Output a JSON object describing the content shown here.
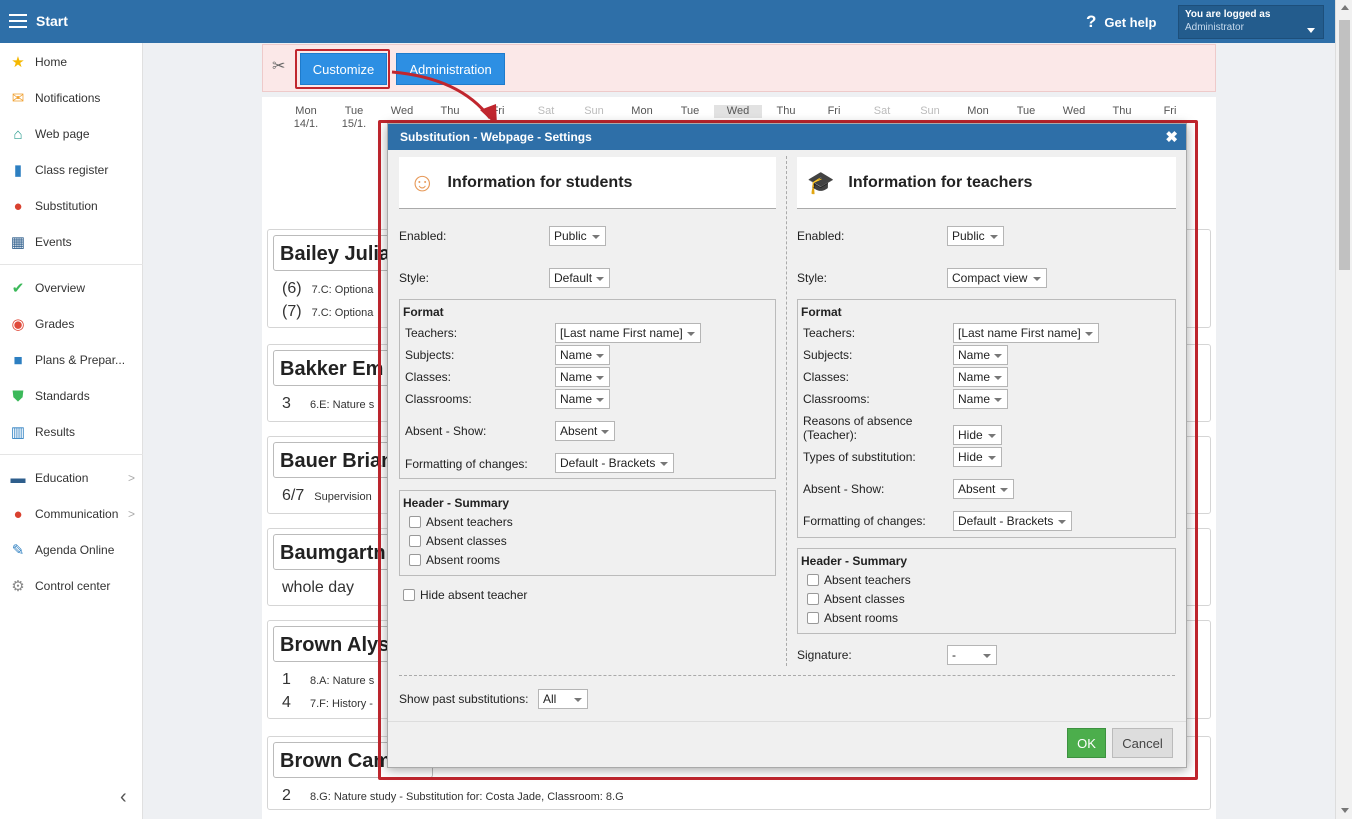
{
  "topbar": {
    "title": "Start",
    "help": "Get help",
    "login_line1": "You are logged as",
    "login_line2": "Administrator"
  },
  "sidebar": {
    "items": [
      {
        "label": "Home",
        "icon": "star-icon"
      },
      {
        "label": "Notifications",
        "icon": "envelope-icon"
      },
      {
        "label": "Web page",
        "icon": "house-icon"
      },
      {
        "label": "Class register",
        "icon": "book-icon"
      },
      {
        "label": "Substitution",
        "icon": "person-icon"
      },
      {
        "label": "Events",
        "icon": "calendar-icon"
      },
      {
        "label": "Overview",
        "icon": "check-circle-icon"
      },
      {
        "label": "Grades",
        "icon": "grade-icon"
      },
      {
        "label": "Plans & Prepar...",
        "icon": "briefcase-icon"
      },
      {
        "label": "Standards",
        "icon": "shield-icon"
      },
      {
        "label": "Results",
        "icon": "bar-chart-icon"
      },
      {
        "label": "Education",
        "icon": "open-book-icon"
      },
      {
        "label": "Communication",
        "icon": "chat-icon"
      },
      {
        "label": "Agenda Online",
        "icon": "pen-icon"
      },
      {
        "label": "Control center",
        "icon": "gear-icon"
      }
    ]
  },
  "toolbar": {
    "customize": "Customize",
    "administration": "Administration"
  },
  "days": [
    {
      "d": "Mon",
      "date": "14/1."
    },
    {
      "d": "Tue",
      "date": "15/1."
    },
    {
      "d": "Wed",
      "date": ""
    },
    {
      "d": "Thu",
      "date": ""
    },
    {
      "d": "Fri",
      "date": ""
    },
    {
      "d": "Sat",
      "date": ""
    },
    {
      "d": "Sun",
      "date": ""
    },
    {
      "d": "Mon",
      "date": ""
    },
    {
      "d": "Tue",
      "date": ""
    },
    {
      "d": "Wed",
      "date": ""
    },
    {
      "d": "Thu",
      "date": ""
    },
    {
      "d": "Fri",
      "date": ""
    },
    {
      "d": "Sat",
      "date": ""
    },
    {
      "d": "Sun",
      "date": ""
    },
    {
      "d": "Mon",
      "date": ""
    },
    {
      "d": "Tue",
      "date": ""
    },
    {
      "d": "Wed",
      "date": ""
    },
    {
      "d": "Thu",
      "date": ""
    },
    {
      "d": "Fri",
      "date": ""
    }
  ],
  "cards": [
    {
      "name": "Bailey Julia",
      "rows": [
        {
          "num": "(6)",
          "text": "7.C: Optiona"
        },
        {
          "num": "(7)",
          "text": "7.C: Optiona"
        }
      ]
    },
    {
      "name": "Bakker Em",
      "rows": [
        {
          "num": "3",
          "text": "6.E: Nature s"
        }
      ]
    },
    {
      "name": "Bauer Brian",
      "rows": [
        {
          "num": "6/7",
          "text": "Supervision"
        }
      ]
    },
    {
      "name": "Baumgartn",
      "rows": [
        {
          "num": "whole day",
          "text": ""
        }
      ]
    },
    {
      "name": "Brown Alys",
      "rows": [
        {
          "num": "1",
          "text": "8.A: Nature s"
        },
        {
          "num": "4",
          "text": "7.F: History -"
        }
      ]
    },
    {
      "name": "Brown Cam",
      "rows": [
        {
          "num": "2",
          "text": "8.G: Nature study - Substitution for: Costa Jade, Classroom: 8.G"
        }
      ]
    }
  ],
  "dialog": {
    "title": "Substitution - Webpage - Settings",
    "students": {
      "heading": "Information for students",
      "enabled_label": "Enabled:",
      "enabled": "Public",
      "style_label": "Style:",
      "style": "Default",
      "format_legend": "Format",
      "teachers_label": "Teachers:",
      "teachers": "[Last name First name]",
      "subjects_label": "Subjects:",
      "subjects": "Name",
      "classes_label": "Classes:",
      "classes": "Name",
      "classrooms_label": "Classrooms:",
      "classrooms": "Name",
      "absent_label": "Absent - Show:",
      "absent": "Absent",
      "formatting_label": "Formatting of changes:",
      "formatting": "Default - Brackets",
      "header_legend": "Header - Summary",
      "chk1": "Absent teachers",
      "chk2": "Absent classes",
      "chk3": "Absent rooms",
      "hide_absent": "Hide absent teacher"
    },
    "teachers": {
      "heading": "Information for teachers",
      "enabled_label": "Enabled:",
      "enabled": "Public",
      "style_label": "Style:",
      "style": "Compact view",
      "format_legend": "Format",
      "teachers_label": "Teachers:",
      "teachers": "[Last name First name]",
      "subjects_label": "Subjects:",
      "subjects": "Name",
      "classes_label": "Classes:",
      "classes": "Name",
      "classrooms_label": "Classrooms:",
      "classrooms": "Name",
      "reasons_label1": "Reasons of absence",
      "reasons_label2": "(Teacher):",
      "reasons": "Hide",
      "types_label": "Types of substitution:",
      "types": "Hide",
      "absent_label": "Absent - Show:",
      "absent": "Absent",
      "formatting_label": "Formatting of changes:",
      "formatting": "Default - Brackets",
      "header_legend": "Header - Summary",
      "chk1": "Absent teachers",
      "chk2": "Absent classes",
      "chk3": "Absent rooms",
      "signature_label": "Signature:",
      "signature": "-"
    },
    "past_label": "Show past substitutions:",
    "past": "All",
    "ok": "OK",
    "cancel": "Cancel"
  }
}
